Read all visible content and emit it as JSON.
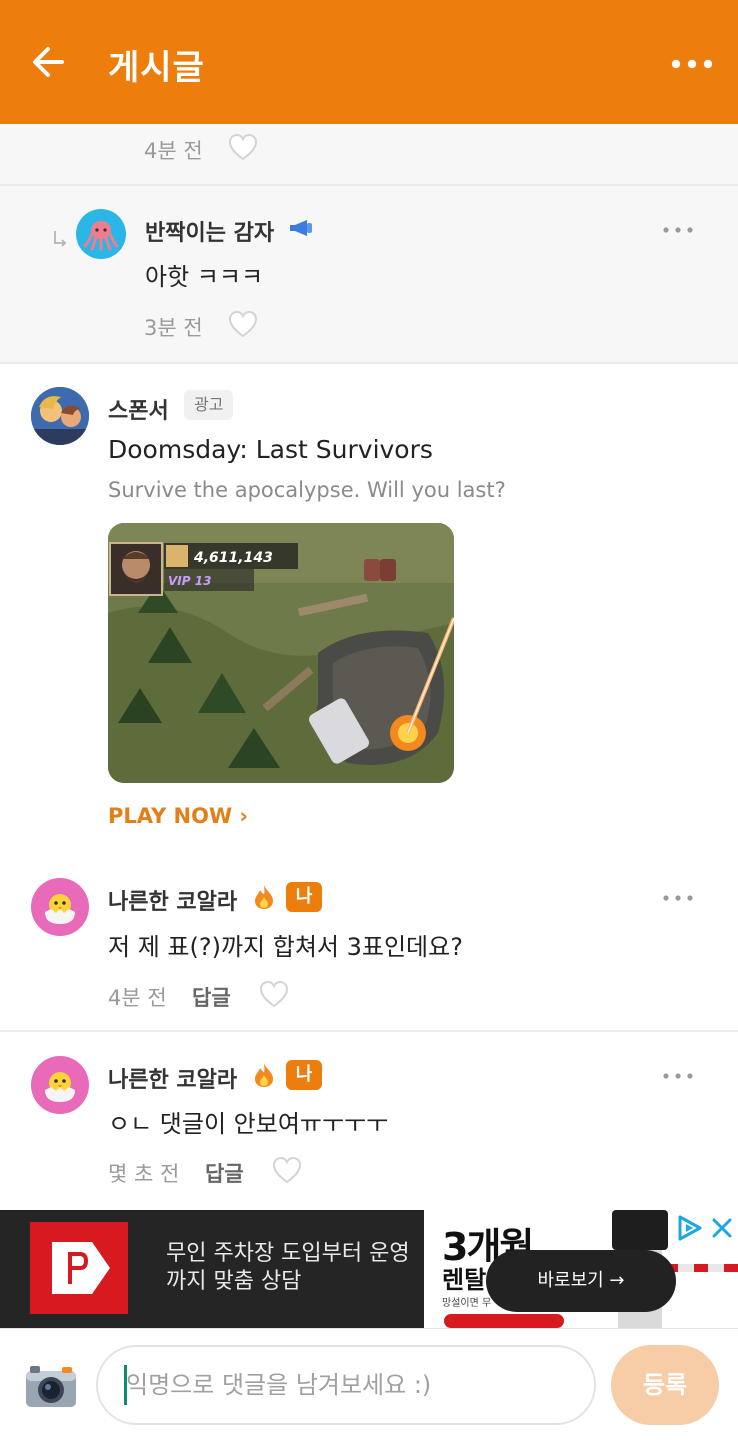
{
  "header": {
    "title": "게시글",
    "back_icon": "arrow-left-icon",
    "more_icon": "more-horizontal-icon",
    "background": "#ED7D0C"
  },
  "comments": [
    {
      "time": "4분 전",
      "partial": true
    },
    {
      "is_reply": true,
      "nickname": "반짝이는 감자",
      "badge_icon": "megaphone-icon",
      "avatar_icon": "octopus-icon",
      "text": "아핫 ㅋㅋㅋ",
      "time": "3분 전"
    }
  ],
  "sponsor": {
    "label": "스폰서",
    "badge": "광고",
    "title": "Doomsday: Last Survivors",
    "description": "Survive the apocalypse. Will you last?",
    "game_stats": {
      "power": "4,611,143",
      "vip": "VIP 13"
    },
    "cta": "PLAY NOW ›"
  },
  "comments_after": [
    {
      "nickname": "나른한 코알라",
      "fire_icon": "fire-icon",
      "author_badge": "나",
      "avatar_icon": "chick-icon",
      "text": "저 제 표(?)까지 합쳐서 3표인데요?",
      "time": "4분 전",
      "reply_label": "답글"
    },
    {
      "nickname": "나른한 코알라",
      "fire_icon": "fire-icon",
      "author_badge": "나",
      "avatar_icon": "chick-icon",
      "text": "ㅇㄴ 댓글이 안보여ㅠㅜㅜㅜ",
      "time": "몇 초 전",
      "reply_label": "답글"
    }
  ],
  "banner_ad": {
    "text": "무인 주차장 도입부터 운영까지 맞춤 상담",
    "headline": "3개월",
    "subline": "렌탈",
    "fine_print": "망설이면 무",
    "cta": "바로보기 →"
  },
  "input_bar": {
    "placeholder": "익명으로 댓글을 남겨보세요 :)",
    "submit_label": "등록",
    "camera_icon": "camera-icon"
  },
  "colors": {
    "accent": "#ED7D0C",
    "submit_disabled": "#F6CDA6",
    "cta": "#E37F18"
  }
}
